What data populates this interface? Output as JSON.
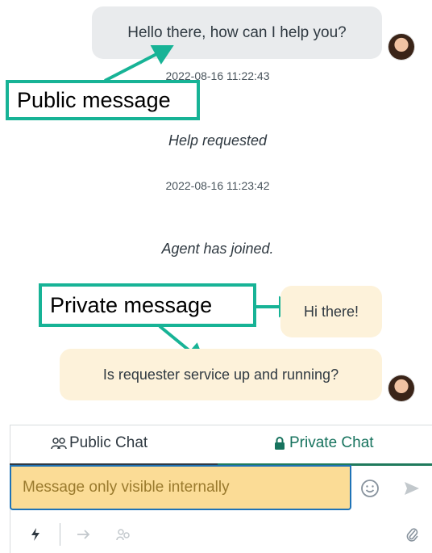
{
  "messages": {
    "public_text": "Hello there, how can I help you?",
    "public_time": "2022-08-16 11:22:43",
    "system_help": "Help requested",
    "system_time": "2022-08-16 11:23:42",
    "system_join": "Agent has joined.",
    "private_1": "Hi there!",
    "private_2": "Is requester service up and running?"
  },
  "annotations": {
    "public_label": "Public message",
    "private_label": "Private message",
    "color": "#17b396"
  },
  "composer": {
    "tab_public": "Public Chat",
    "tab_private": "Private Chat",
    "input_placeholder": "Message only visible internally",
    "icons": [
      "emoji-icon",
      "send-icon",
      "shortcut-icon",
      "forward-icon",
      "users-icon",
      "attach-icon"
    ]
  },
  "colors": {
    "public_bubble": "#e9ebed",
    "private_bubble": "#fdf2da",
    "private_input": "#fbdc96",
    "private_accent": "#17735e"
  }
}
